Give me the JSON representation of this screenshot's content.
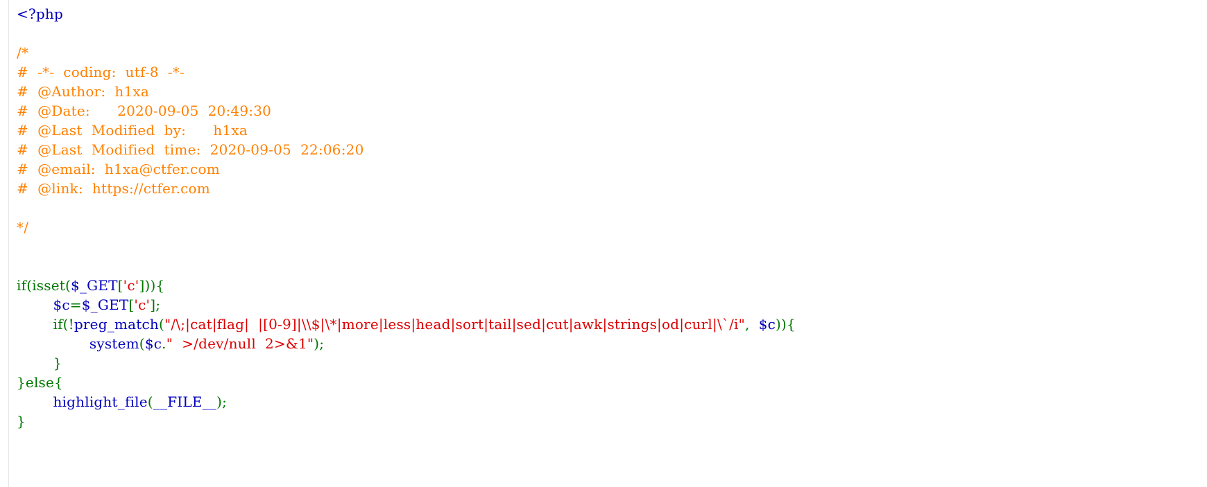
{
  "colors": {
    "default": "#0000BB",
    "comment": "#FF8000",
    "keyword": "#007700",
    "string": "#DD0000",
    "background": "#FFFFFF"
  },
  "code": {
    "l1": "<?php",
    "comment": {
      "open": "/*",
      "coding": "#  -*-  coding:  utf-8  -*-",
      "author": "#  @Author:  h1xa",
      "date": "#  @Date:      2020-09-05  20:49:30",
      "modified_by": "#  @Last  Modified  by:      h1xa",
      "modified_time": "#  @Last  Modified  time:  2020-09-05  22:06:20",
      "email": "#  @email:  h1xa@ctfer.com",
      "link": "#  @link:  https://ctfer.com",
      "close": "*/"
    },
    "if_line": {
      "kw1": "if(isset(",
      "var": "$_GET",
      "kw2": "[",
      "str": "'c'",
      "kw3": "])){"
    },
    "assign_line": {
      "indent": "        ",
      "var1": "$c",
      "kw1": "=",
      "var2": "$_GET",
      "kw2": "[",
      "str": "'c'",
      "kw3": "];"
    },
    "preg_line": {
      "indent": "        ",
      "kw1": "if(!",
      "fn": "preg_match",
      "kw2": "(",
      "str": "\"/\\;|cat|flag|  |[0-9]|\\\\$|\\*|more|less|head|sort|tail|sed|cut|awk|strings|od|curl|\\`/i\"",
      "kw3": ",  ",
      "var": "$c",
      "kw4": ")){"
    },
    "system_line": {
      "indent": "                ",
      "fn": "system",
      "kw1": "(",
      "var": "$c",
      "kw2": ".",
      "str": "\"  >/dev/null  2>&1\"",
      "kw3": ");"
    },
    "inner_close": "        }",
    "else_line": "}else{",
    "highlight_line": {
      "indent": "        ",
      "fn": "highlight_file",
      "kw1": "(",
      "const": "__FILE__",
      "kw2": ");"
    },
    "outer_close": "}"
  }
}
